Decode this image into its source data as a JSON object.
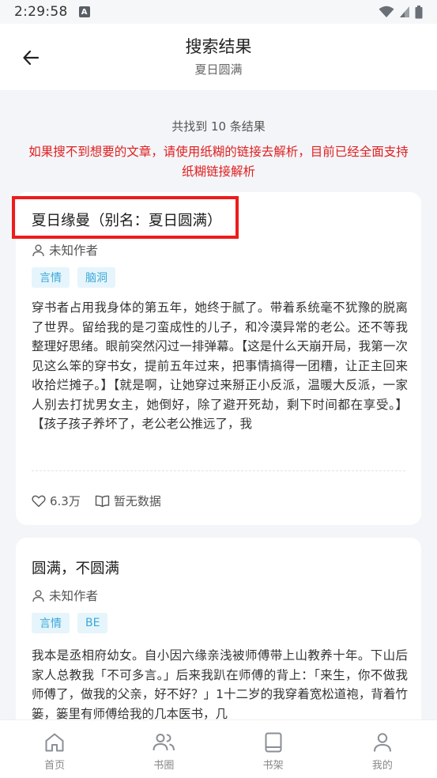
{
  "status_bar": {
    "time": "2:29:58",
    "notification_letter": "A"
  },
  "header": {
    "title": "搜索结果",
    "subtitle": "夏日圆满"
  },
  "summary": {
    "count_text": "共找到 10 条结果",
    "notice": "如果搜不到想要的文章，请使用纸糊的链接去解析，目前已经全面支持纸糊链接解析"
  },
  "results": [
    {
      "title": "夏日缘曼（别名：夏日圆满）",
      "author": "未知作者",
      "tags": [
        "言情",
        "脑洞"
      ],
      "summary": "穿书者占用我身体的第五年，她终于腻了。带着系统毫不犹豫的脱离了世界。留给我的是刁蛮成性的儿子，和冷漠异常的老公。还不等我整理好思绪。眼前突然闪过一排弹幕。【这是什么天崩开局，我第一次见这么笨的穿书女，提前五年过来，把事情搞得一团糟，让正主回来收拾烂摊子。】【就是啊，让她穿过来掰正小反派，温暖大反派，一家人别去打扰男女主，她倒好，除了避开死劫，剩下时间都在享受。】【孩子孩子养坏了，老公老公推远了，我",
      "likes": "6.3万",
      "reads": "暂无数据"
    },
    {
      "title": "圆满，不圆满",
      "author": "未知作者",
      "tags": [
        "言情",
        "BE"
      ],
      "summary": "我本是丞相府幼女。自小因六缘亲浅被师傅带上山教养十年。下山后家人总教我「不可多言。」后来我趴在师傅的背上：「来生，你不做我师傅了，做我的父亲，好不好？」1十二岁的我穿着宽松道袍，背着竹篓，篓里有师傅给我的几本医书，几"
    }
  ],
  "tab_bar": {
    "items": [
      {
        "label": "首页"
      },
      {
        "label": "书圈"
      },
      {
        "label": "书架"
      },
      {
        "label": "我的"
      }
    ]
  },
  "colors": {
    "notice": "#e02020",
    "highlight_box": "#ee1c1c",
    "tag_text": "#3aa8d8",
    "tag_bg": "#e6f5fb",
    "background": "#f3f5f8"
  },
  "icons": {
    "back": "arrow-left-icon",
    "author": "user-outline-icon",
    "likes": "heart-outline-icon",
    "reads": "open-book-icon",
    "tabs": [
      "home-icon",
      "users-icon",
      "bookshelf-icon",
      "profile-icon"
    ]
  }
}
